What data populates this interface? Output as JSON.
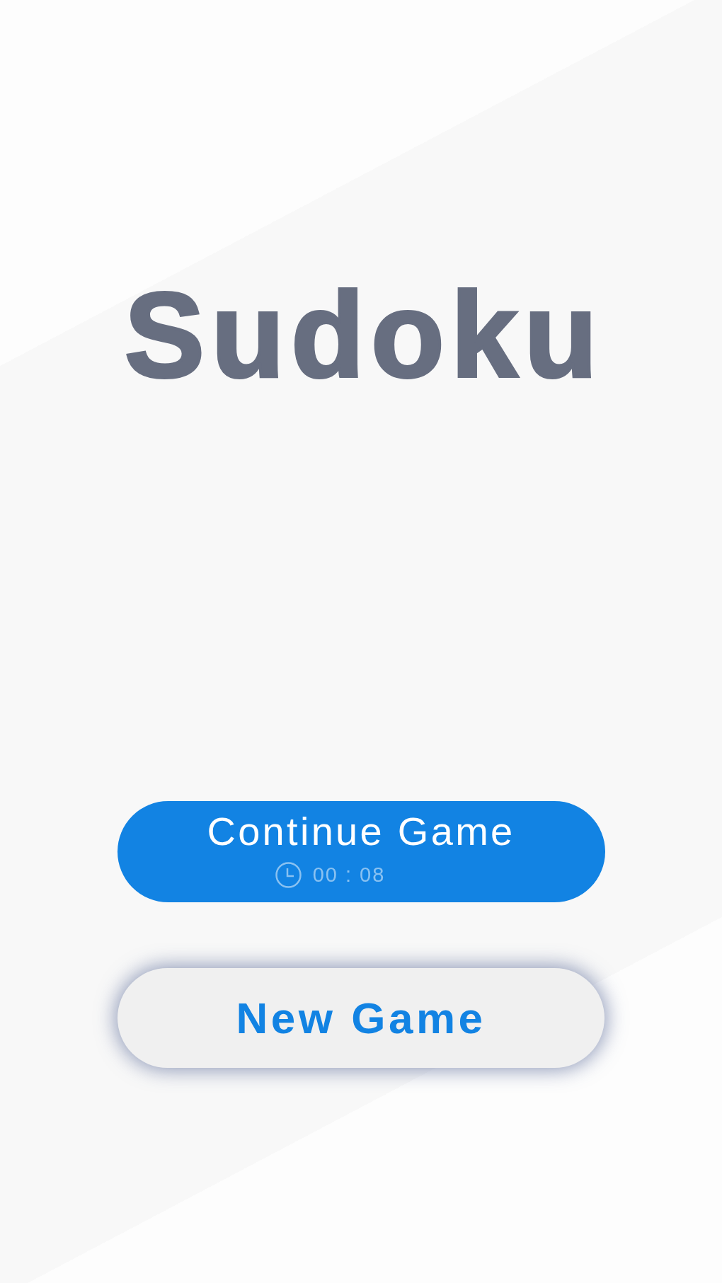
{
  "title": "Sudoku",
  "buttons": [
    {
      "kind": "continue",
      "label": "Continue Game",
      "timer": "00 : 08"
    },
    {
      "kind": "new",
      "label": "New Game"
    }
  ]
}
